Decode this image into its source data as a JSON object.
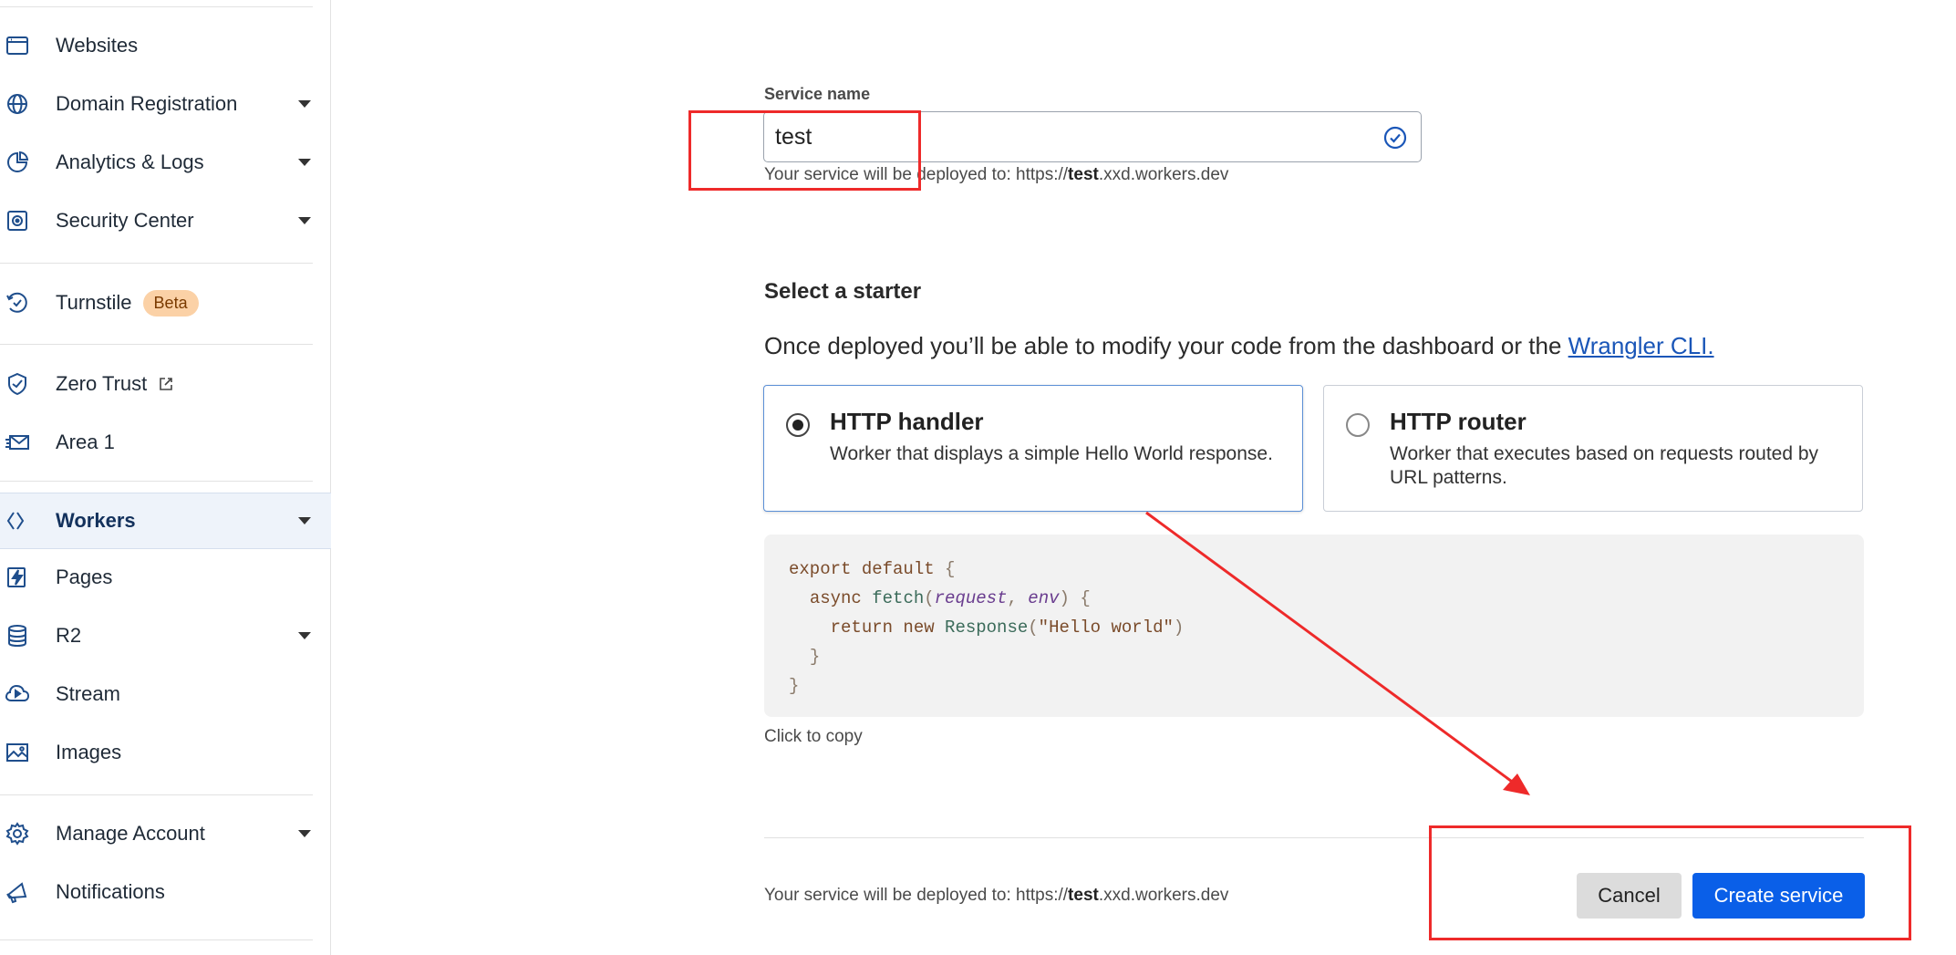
{
  "sidebar": {
    "items": [
      {
        "label": "Websites",
        "icon": "browser-window-icon",
        "caret": false
      },
      {
        "label": "Domain Registration",
        "icon": "globe-icon",
        "caret": true
      },
      {
        "label": "Analytics & Logs",
        "icon": "pie-chart-icon",
        "caret": true
      },
      {
        "label": "Security Center",
        "icon": "shield-chip-icon",
        "caret": true
      },
      {
        "label": "Turnstile",
        "icon": "turnstile-icon",
        "caret": false,
        "badge": "Beta"
      },
      {
        "label": "Zero Trust",
        "icon": "zero-trust-icon",
        "caret": false,
        "external": true
      },
      {
        "label": "Area 1",
        "icon": "mail-icon",
        "caret": false
      },
      {
        "label": "Workers",
        "icon": "workers-icon",
        "caret": true,
        "active": true
      },
      {
        "label": "Pages",
        "icon": "pages-lightning-icon",
        "caret": false
      },
      {
        "label": "R2",
        "icon": "database-icon",
        "caret": true
      },
      {
        "label": "Stream",
        "icon": "cloud-play-icon",
        "caret": false
      },
      {
        "label": "Images",
        "icon": "image-icon",
        "caret": false
      },
      {
        "label": "Manage Account",
        "icon": "gear-icon",
        "caret": true
      },
      {
        "label": "Notifications",
        "icon": "megaphone-icon",
        "caret": false
      }
    ]
  },
  "form": {
    "service_name_label": "Service name",
    "service_name_value": "test",
    "deploy_prefix": "Your service will be deployed to: https://",
    "deploy_subdomain": "test",
    "deploy_suffix": ".xxd.workers.dev"
  },
  "starter": {
    "heading": "Select a starter",
    "description": "Once deployed you’ll be able to modify your code from the dashboard or the ",
    "link_text": "Wrangler CLI.",
    "options": [
      {
        "title": "HTTP handler",
        "description": "Worker that displays a simple Hello World response.",
        "selected": true
      },
      {
        "title": "HTTP router",
        "description": "Worker that executes based on requests routed by URL patterns.",
        "selected": false
      }
    ]
  },
  "code": {
    "line1_kw": "export default",
    "line1_punc": " {",
    "line2_kw": "async",
    "line2_fn": "fetch",
    "line2_p1": "request",
    "line2_p2": "env",
    "line3_kw": "return new",
    "line3_fn": "Response",
    "line3_str": "\"Hello world\"",
    "line4": "}",
    "line5": "}",
    "copy_hint": "Click to copy"
  },
  "footer": {
    "cancel_label": "Cancel",
    "create_label": "Create service"
  },
  "colors": {
    "primary": "#0a5fe8",
    "link": "#1a56b8",
    "annotation": "#ee2a2a",
    "beta_badge": "#fbd1a6"
  }
}
